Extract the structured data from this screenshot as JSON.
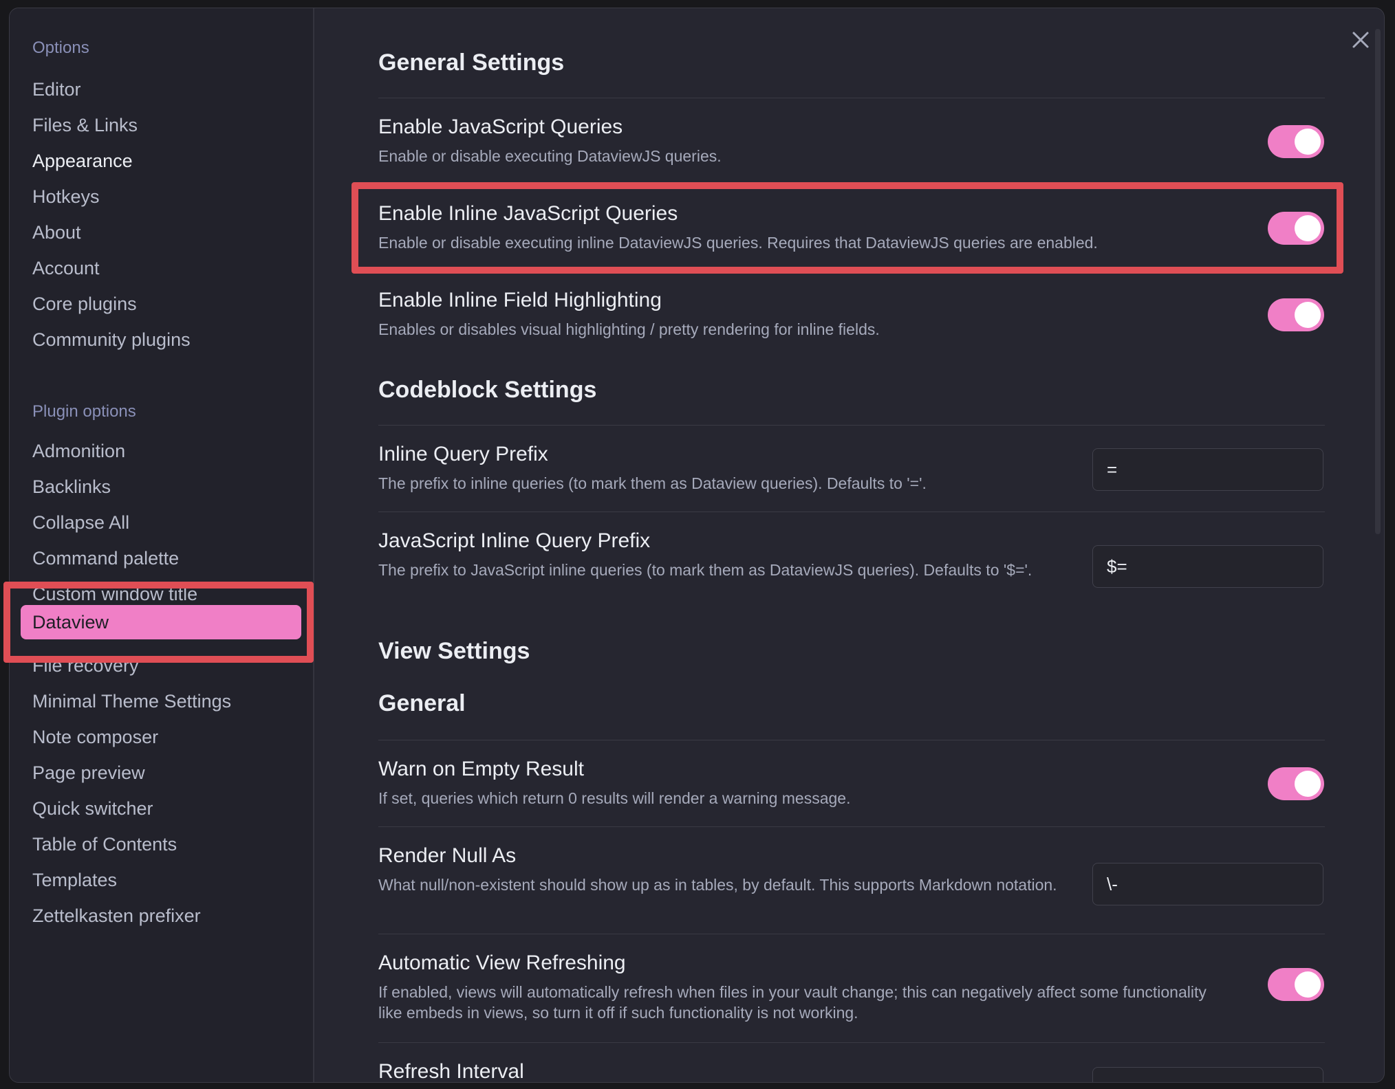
{
  "sidebar": {
    "options_heading": "Options",
    "options_items": [
      "Editor",
      "Files & Links",
      "Appearance",
      "Hotkeys",
      "About",
      "Account",
      "Core plugins",
      "Community plugins"
    ],
    "plugin_heading": "Plugin options",
    "plugin_items": [
      "Admonition",
      "Backlinks",
      "Collapse All",
      "Command palette",
      "Custom window title",
      "Dataview",
      "File recovery",
      "Minimal Theme Settings",
      "Note composer",
      "Page preview",
      "Quick switcher",
      "Table of Contents",
      "Templates",
      "Zettelkasten prefixer"
    ],
    "active_item": "Dataview"
  },
  "content": {
    "general_title": "General Settings",
    "codeblock_title": "Codeblock Settings",
    "view_title": "View Settings",
    "general_sub_title": "General",
    "settings": {
      "js_queries": {
        "name": "Enable JavaScript Queries",
        "desc": "Enable or disable executing DataviewJS queries.",
        "enabled": true
      },
      "inline_js": {
        "name": "Enable Inline JavaScript Queries",
        "desc": "Enable or disable executing inline DataviewJS queries. Requires that DataviewJS queries are enabled.",
        "enabled": true
      },
      "field_highlight": {
        "name": "Enable Inline Field Highlighting",
        "desc": "Enables or disables visual highlighting / pretty rendering for inline fields.",
        "enabled": true
      },
      "query_prefix": {
        "name": "Inline Query Prefix",
        "desc": "The prefix to inline queries (to mark them as Dataview queries). Defaults to '='.",
        "value": "="
      },
      "js_prefix": {
        "name": "JavaScript Inline Query Prefix",
        "desc": "The prefix to JavaScript inline queries (to mark them as DataviewJS queries). Defaults to '$='.",
        "value": "$="
      },
      "warn_empty": {
        "name": "Warn on Empty Result",
        "desc": "If set, queries which return 0 results will render a warning message.",
        "enabled": true
      },
      "render_null": {
        "name": "Render Null As",
        "desc": "What null/non-existent should show up as in tables, by default. This supports Markdown notation.",
        "value": "\\-"
      },
      "auto_refresh": {
        "name": "Automatic View Refreshing",
        "desc": "If enabled, views will automatically refresh when files in your vault change; this can negatively affect some functionality like embeds in views, so turn it off if such functionality is not working.",
        "enabled": true
      },
      "refresh_interval": {
        "name": "Refresh Interval"
      }
    }
  },
  "colors": {
    "accent": "#f07fc6",
    "highlight_box": "#e04e55",
    "background": "#262630"
  }
}
